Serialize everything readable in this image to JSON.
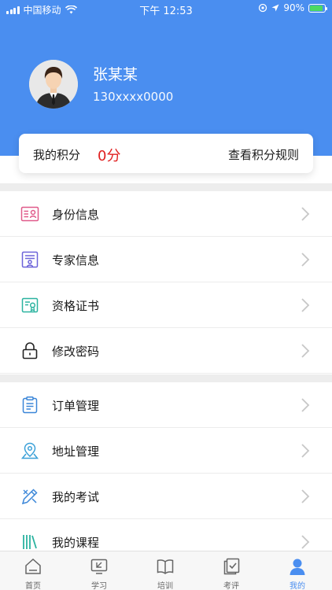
{
  "status_bar": {
    "carrier": "中国移动",
    "time": "下午 12:53",
    "battery": "90%",
    "battery_level": 0.9
  },
  "profile": {
    "name": "张某某",
    "phone": "130xxxx0000"
  },
  "points": {
    "label": "我的积分",
    "value": "0分",
    "rules_link": "查看积分规则"
  },
  "menu_group1": [
    {
      "label": "身份信息",
      "icon": "id-card-icon"
    },
    {
      "label": "专家信息",
      "icon": "expert-profile-icon"
    },
    {
      "label": "资格证书",
      "icon": "certificate-icon"
    },
    {
      "label": "修改密码",
      "icon": "lock-icon"
    }
  ],
  "menu_group2": [
    {
      "label": "订单管理",
      "icon": "order-list-icon"
    },
    {
      "label": "地址管理",
      "icon": "location-pin-icon"
    },
    {
      "label": "我的考试",
      "icon": "exam-pencil-icon"
    },
    {
      "label": "我的课程",
      "icon": "books-icon"
    }
  ],
  "tabbar": {
    "items": [
      {
        "label": "首页",
        "icon": "home-icon"
      },
      {
        "label": "学习",
        "icon": "study-icon"
      },
      {
        "label": "培训",
        "icon": "book-open-icon"
      },
      {
        "label": "考评",
        "icon": "evaluation-icon"
      },
      {
        "label": "我的",
        "icon": "person-icon"
      }
    ],
    "active_index": 4
  },
  "colors": {
    "header_blue": "#4a8ef0",
    "points_red": "#e02020",
    "active_tab": "#4a8ef0"
  }
}
